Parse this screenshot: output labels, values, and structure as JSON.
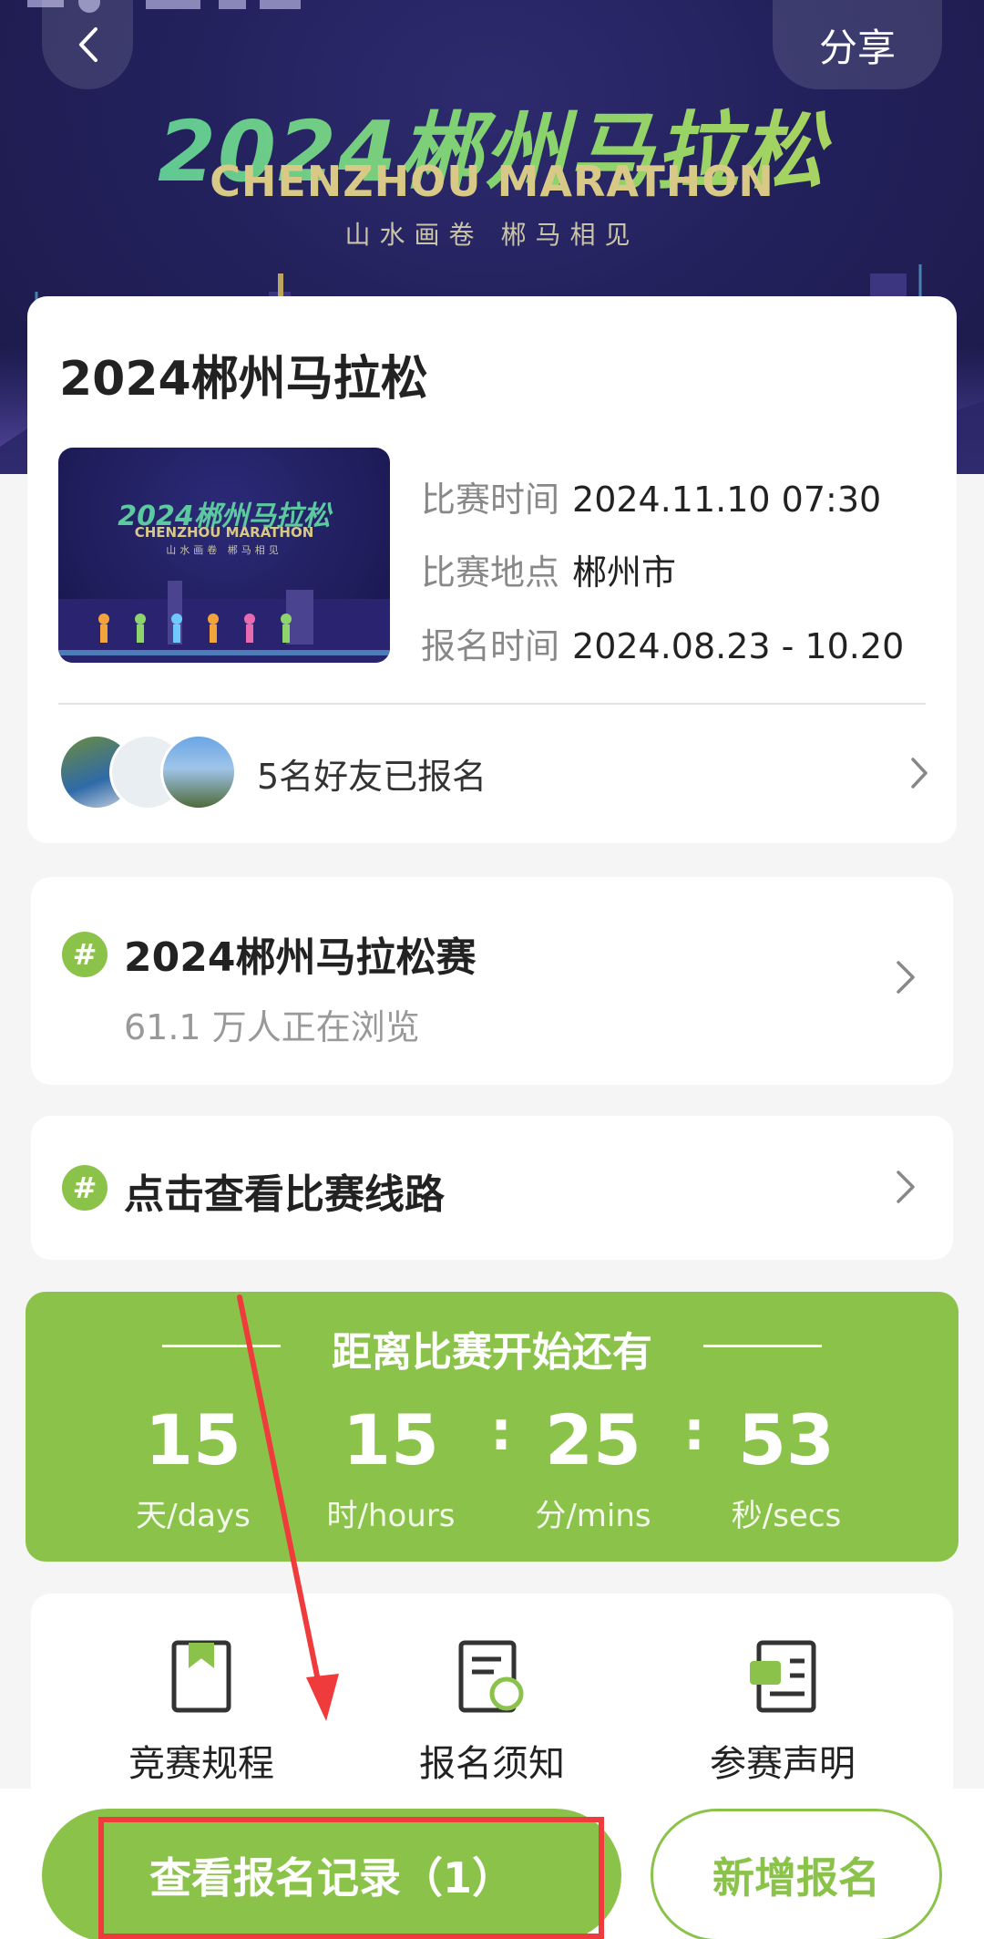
{
  "header": {
    "share_label": "分享"
  },
  "banner": {
    "title": "2024郴州马拉松",
    "subtitle": "CHENZHOU MARATHON",
    "slogan": "山水画卷 郴马相见"
  },
  "event": {
    "title": "2024郴州马拉松",
    "race_time_label": "比赛时间",
    "race_time": "2024.11.10 07:30",
    "location_label": "比赛地点",
    "location": "郴州市",
    "signup_label": "报名时间",
    "signup_time": "2024.08.23 - 10.20",
    "friends_text": "5名好友已报名"
  },
  "topics": [
    {
      "title": "2024郴州马拉松赛",
      "subtitle": "61.1 万人正在浏览"
    },
    {
      "title": "点击查看比赛线路"
    }
  ],
  "countdown": {
    "title": "距离比赛开始还有",
    "days": "15",
    "days_unit": "天/days",
    "hours": "15",
    "hours_unit": "时/hours",
    "mins": "25",
    "mins_unit": "分/mins",
    "secs": "53",
    "secs_unit": "秒/secs",
    "separator": ":"
  },
  "docs": [
    {
      "label": "竞赛规程",
      "icon": "book-icon"
    },
    {
      "label": "报名须知",
      "icon": "notice-doc-icon"
    },
    {
      "label": "参赛声明",
      "icon": "statement-doc-icon"
    }
  ],
  "actions": {
    "records_label": "查看报名记录（1）",
    "new_label": "新增报名"
  },
  "colors": {
    "accent": "#8bc34a",
    "annotation": "#ef3b3b",
    "banner_bg": "#23215c"
  }
}
